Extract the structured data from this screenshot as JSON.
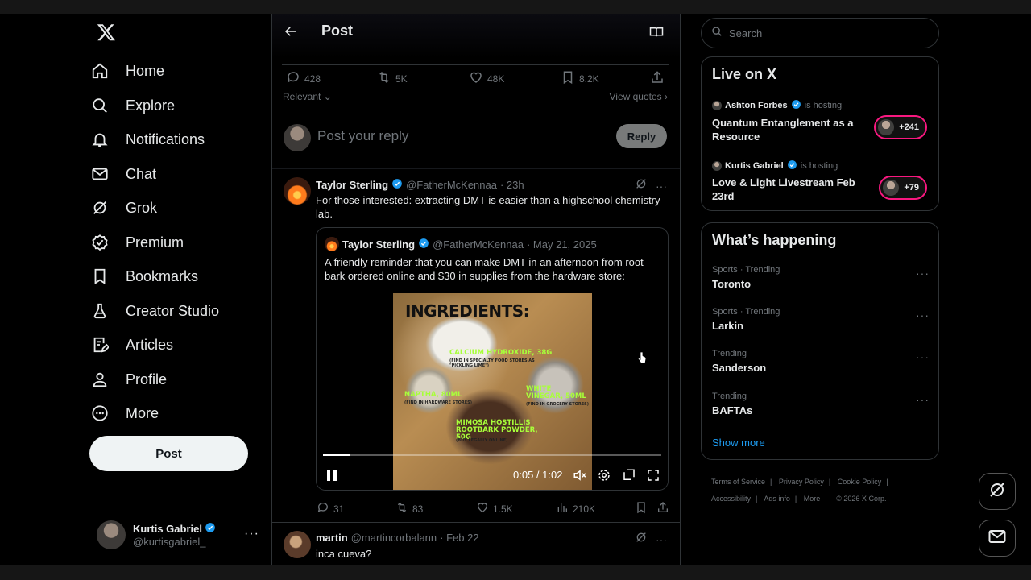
{
  "nav": {
    "items": [
      {
        "label": "Home",
        "icon": "home-icon"
      },
      {
        "label": "Explore",
        "icon": "search-icon"
      },
      {
        "label": "Notifications",
        "icon": "bell-icon"
      },
      {
        "label": "Chat",
        "icon": "mail-icon"
      },
      {
        "label": "Grok",
        "icon": "grok-icon"
      },
      {
        "label": "Premium",
        "icon": "verified-icon"
      },
      {
        "label": "Bookmarks",
        "icon": "bookmark-icon"
      },
      {
        "label": "Creator Studio",
        "icon": "creator-icon"
      },
      {
        "label": "Articles",
        "icon": "article-icon"
      },
      {
        "label": "Profile",
        "icon": "person-icon"
      },
      {
        "label": "More",
        "icon": "more-circle-icon"
      }
    ],
    "post_label": "Post",
    "account": {
      "name": "Kurtis Gabriel",
      "handle": "@kurtisgabriel_"
    }
  },
  "header": {
    "title": "Post"
  },
  "post_stats": {
    "replies": "428",
    "reposts": "5K",
    "likes": "48K",
    "bookmarks": "8.2K"
  },
  "sort": {
    "label": "Relevant",
    "view_quotes": "View quotes"
  },
  "composer": {
    "placeholder": "Post your reply",
    "reply_label": "Reply"
  },
  "replies": [
    {
      "name": "Taylor Sterling",
      "handle": "@FatherMcKennaa",
      "time": "· 23h",
      "text": "For those interested: extracting DMT is easier than a highschool chemistry lab.",
      "quote": {
        "name": "Taylor Sterling",
        "handle": "@FatherMcKennaa",
        "time": "· May 21, 2025",
        "text": "A friendly reminder that you can make DMT in an afternoon from root bark ordered online and $30 in supplies from the hardware store:",
        "video": {
          "title": "INGREDIENTS:",
          "items": [
            {
              "label": "CALCIUM HYDROXIDE, 38G",
              "note": "(FIND IN SPECIALTY FOOD STORES AS \"PICKLING LIME\")"
            },
            {
              "label": "NAPTHA, 80ML",
              "note": "(FIND IN HARDWARE STORES)"
            },
            {
              "label": "WHITE VINEGAR, 50ML",
              "note": "(FIND IN GROCERY STORES)"
            },
            {
              "label": "MIMOSA HOSTILLIS ROOTBARK POWDER, 50G",
              "note": "(BUY LEGALLY ONLINE)"
            }
          ],
          "time": "0:05 / 1:02",
          "progress": 0.08
        }
      },
      "stats": {
        "replies": "31",
        "reposts": "83",
        "likes": "1.5K",
        "views": "210K"
      }
    },
    {
      "name": "martin",
      "handle": "@martincorbalann",
      "time": "· Feb 22",
      "text": "inca cueva?"
    }
  ],
  "right": {
    "search_placeholder": "Search",
    "live": {
      "title": "Live on X",
      "spaces": [
        {
          "host": "Ashton Forbes",
          "hosting": "is hosting",
          "title": "Quantum Entanglement as a Resource",
          "count": "+241"
        },
        {
          "host": "Kurtis Gabriel",
          "hosting": "is hosting",
          "title": "Love & Light Livestream Feb 23rd",
          "count": "+79"
        }
      ]
    },
    "happening": {
      "title": "What’s happening",
      "trends": [
        {
          "context": "Sports · Trending",
          "name": "Toronto"
        },
        {
          "context": "Sports · Trending",
          "name": "Larkin"
        },
        {
          "context": "Trending",
          "name": "Sanderson"
        },
        {
          "context": "Trending",
          "name": "BAFTAs"
        }
      ],
      "show_more": "Show more"
    },
    "footer": [
      "Terms of Service",
      "|",
      "Privacy Policy",
      "|",
      "Cookie Policy",
      "|",
      "Accessibility",
      "|",
      "Ads info",
      "|",
      "More ···",
      "© 2026 X Corp."
    ]
  },
  "colors": {
    "accent": "#1d9bf0",
    "live_border": "#f91880",
    "background": "#000000"
  }
}
